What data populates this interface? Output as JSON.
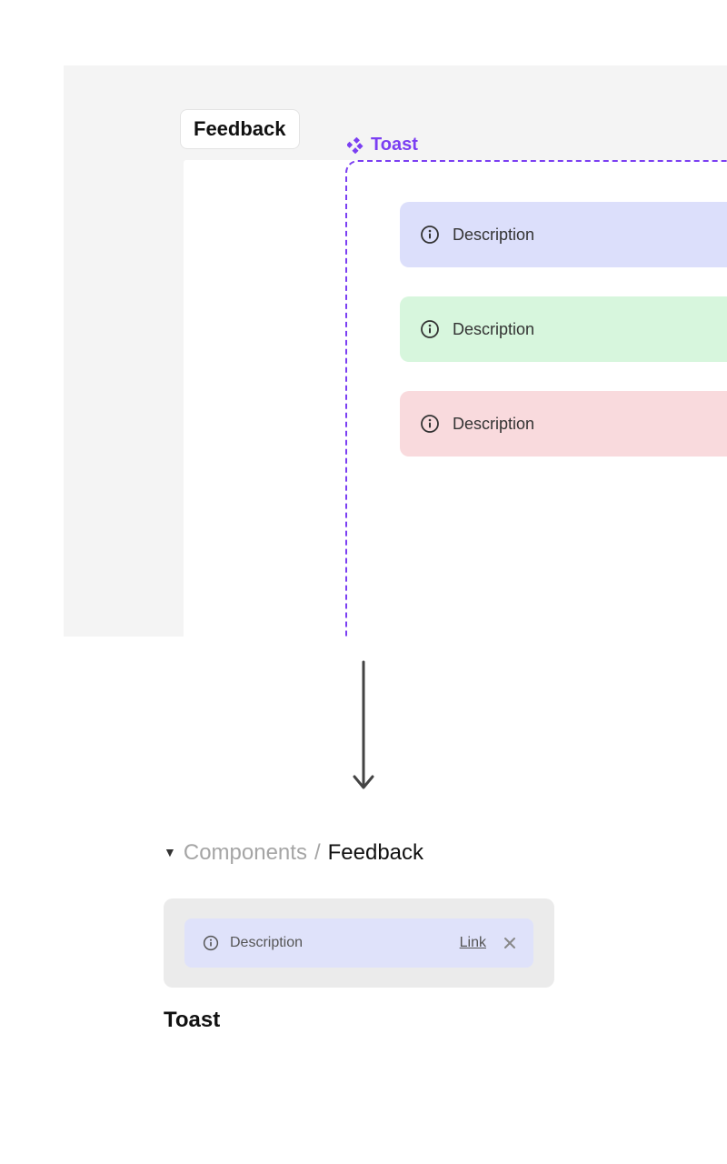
{
  "canvas": {
    "section_label": "Feedback",
    "frame_label": "Toast",
    "toasts": [
      {
        "variant": "info",
        "text": "Description"
      },
      {
        "variant": "success",
        "text": "Description"
      },
      {
        "variant": "error",
        "text": "Description"
      }
    ]
  },
  "library": {
    "breadcrumb": {
      "parent": "Components",
      "separator": "/",
      "current": "Feedback"
    },
    "preview": {
      "text": "Description",
      "link_label": "Link"
    },
    "component_name": "Toast"
  },
  "colors": {
    "frame_accent": "#7b3ff2",
    "toast_info_bg": "#dcdffb",
    "toast_success_bg": "#d7f6dd",
    "toast_error_bg": "#f9dadd"
  }
}
